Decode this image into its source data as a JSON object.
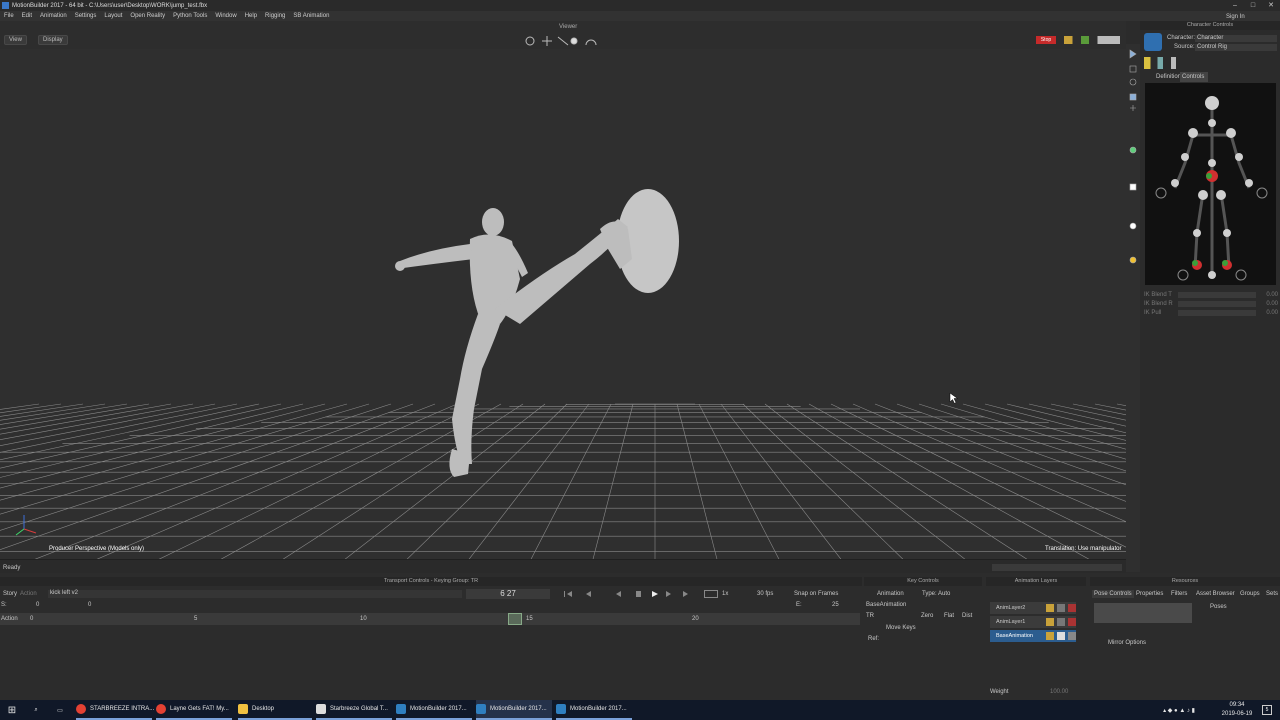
{
  "window": {
    "title": "MotionBuilder 2017  -  64 bit  -  C:\\Users\\user\\Desktop\\WORK\\jump_test.fbx",
    "min": "–",
    "max": "□",
    "close": "✕"
  },
  "menu": [
    "File",
    "Edit",
    "Animation",
    "Settings",
    "Layout",
    "Open Reality",
    "Python Tools",
    "Window",
    "Help",
    "Rigging",
    "SB Animation"
  ],
  "viewer": {
    "title": "Viewer",
    "view_btn": "View",
    "display_btn": "Display",
    "camera_label": "Producer Perspective (Models only)",
    "translation_label": "Translation: Use manipulator",
    "status": "Ready",
    "stop_btn": "Stop"
  },
  "char_controls": {
    "header": "Character Controls",
    "sign_in": "Sign In",
    "character_label": "Character:",
    "character_value": "Character",
    "source_label": "Source:",
    "source_value": "Control Rig",
    "tab_definition": "Definition",
    "tab_controls": "Controls",
    "ik_rows": [
      {
        "label": "IK Blend T",
        "value": "0.00"
      },
      {
        "label": "IK Blend R",
        "value": "0.00"
      },
      {
        "label": "IK Pull",
        "value": "0.00"
      }
    ]
  },
  "transport": {
    "header": "Transport Controls  -  Keying Group: TR",
    "story": "Story",
    "action": "Action",
    "take": "kick left v2",
    "start": "0",
    "current": "0",
    "frame_display": "6  27",
    "speed": "1x",
    "fps": "30 fps",
    "snap": "Snap on Frames",
    "end_frame": "25",
    "end_label": "E:",
    "s_label": "S:",
    "track_label": "Action",
    "ruler_ticks": [
      "0",
      "5",
      "10",
      "15",
      "20"
    ]
  },
  "key_controls": {
    "header": "Key Controls",
    "mode": "Animation",
    "type_label": "Type:",
    "type_value": "Auto",
    "layer": "BaseAnimation",
    "keying": "TR",
    "btn_zero": "Zero",
    "btn_flat": "Flat",
    "btn_dist": "Dist",
    "move_keys": "Move Keys",
    "ref": "Ref:"
  },
  "anim_layers": {
    "header": "Animation Layers",
    "layers": [
      "AnimLayer2",
      "AnimLayer1",
      "BaseAnimation"
    ],
    "weight_label": "Weight",
    "weight_value": "100.00"
  },
  "resources": {
    "header": "Resources",
    "tabs": [
      "Pose Controls",
      "Properties",
      "Filters",
      "Asset Browser",
      "Groups",
      "Sets"
    ],
    "poses": "Poses",
    "mirror": "Mirror Options"
  },
  "taskbar": {
    "items": [
      "STARBREEZE INTRA...",
      "Layne Gets FAT! My...",
      "Desktop",
      "Starbreeze Global T...",
      "MotionBuilder 2017...",
      "MotionBuilder 2017...",
      "MotionBuilder 2017..."
    ],
    "time": "09:34",
    "date": "2019-06-19",
    "notif": "5"
  },
  "colors": {
    "accent": "#2c5d8f",
    "viewport_bg": "#2f2f2f",
    "grid": "#8a8a8a",
    "stop_red": "#c62a2a",
    "taskbar": "#101828"
  }
}
